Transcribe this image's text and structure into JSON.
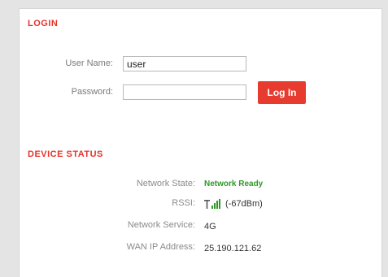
{
  "login": {
    "title": "LOGIN",
    "username_label": "User Name:",
    "username_value": "user",
    "password_label": "Password:",
    "password_value": "",
    "button_label": "Log In"
  },
  "device_status": {
    "title": "DEVICE STATUS",
    "network_state_label": "Network State:",
    "network_state_value": "Network Ready",
    "rssi_label": "RSSI:",
    "rssi_value": "(-67dBm)",
    "rssi_icon": "signal-strength-icon",
    "network_service_label": "Network Service:",
    "network_service_value": "4G",
    "wan_ip_label": "WAN IP Address:",
    "wan_ip_value": "25.190.121.62"
  },
  "colors": {
    "accent": "#e8322a",
    "status_ok": "#2e9a26",
    "background": "#e4e4e4"
  }
}
